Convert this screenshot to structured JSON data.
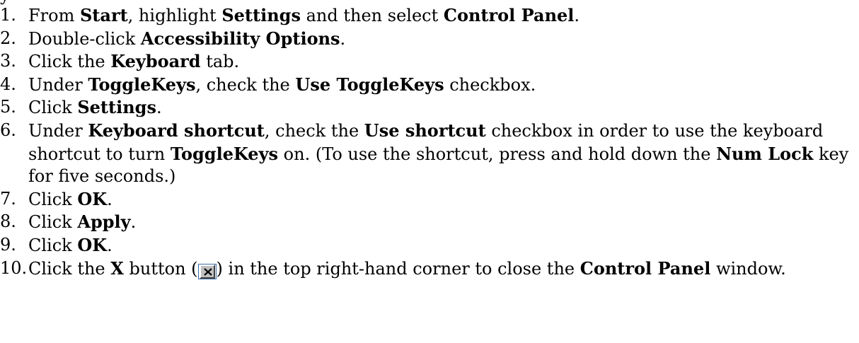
{
  "header_fragment": "y",
  "steps": [
    {
      "num": "1.",
      "parts": [
        [
          "From ",
          false
        ],
        [
          "Start",
          true
        ],
        [
          ", highlight ",
          false
        ],
        [
          "Settings",
          true
        ],
        [
          " and then select ",
          false
        ],
        [
          "Control Panel",
          true
        ],
        [
          ".",
          false
        ]
      ]
    },
    {
      "num": "2.",
      "parts": [
        [
          "Double-click ",
          false
        ],
        [
          "Accessibility Options",
          true
        ],
        [
          ".",
          false
        ]
      ]
    },
    {
      "num": "3.",
      "parts": [
        [
          "Click the ",
          false
        ],
        [
          "Keyboard",
          true
        ],
        [
          " tab.",
          false
        ]
      ]
    },
    {
      "num": "4.",
      "parts": [
        [
          "Under ",
          false
        ],
        [
          "ToggleKeys",
          true
        ],
        [
          ", check the ",
          false
        ],
        [
          "Use ToggleKeys",
          true
        ],
        [
          " checkbox.",
          false
        ]
      ]
    },
    {
      "num": "5.",
      "parts": [
        [
          "Click ",
          false
        ],
        [
          "Settings",
          true
        ],
        [
          ".",
          false
        ]
      ]
    },
    {
      "num": "6.",
      "parts": [
        [
          "Under ",
          false
        ],
        [
          "Keyboard shortcut",
          true
        ],
        [
          ", check the ",
          false
        ],
        [
          "Use shortcut",
          true
        ],
        [
          " checkbox in order to use the keyboard shortcut to turn ",
          false
        ],
        [
          "ToggleKeys",
          true
        ],
        [
          " on. (To use the shortcut, press and hold down the ",
          false
        ],
        [
          "Num Lock",
          true
        ],
        [
          " key for five seconds.)",
          false
        ]
      ]
    },
    {
      "num": "7.",
      "parts": [
        [
          "Click ",
          false
        ],
        [
          "OK",
          true
        ],
        [
          ".",
          false
        ]
      ]
    },
    {
      "num": "8.",
      "parts": [
        [
          "Click ",
          false
        ],
        [
          "Apply",
          true
        ],
        [
          ".",
          false
        ]
      ]
    },
    {
      "num": "9.",
      "parts": [
        [
          "Click ",
          false
        ],
        [
          "OK",
          true
        ],
        [
          ".",
          false
        ]
      ]
    },
    {
      "num": "10.",
      "parts": [
        [
          "Click the ",
          false
        ],
        [
          "X",
          true
        ],
        [
          " button (",
          false
        ],
        [
          "__XBTN__",
          false
        ],
        [
          ") in the top right-hand corner to close the ",
          false
        ],
        [
          "Control Panel",
          true
        ],
        [
          " window.",
          false
        ]
      ]
    }
  ],
  "icons": {
    "close_button": "close-x-icon"
  },
  "colors": {
    "text": "#000000",
    "button_face": "#c0c0c0",
    "button_border": "#3a6ea5"
  }
}
